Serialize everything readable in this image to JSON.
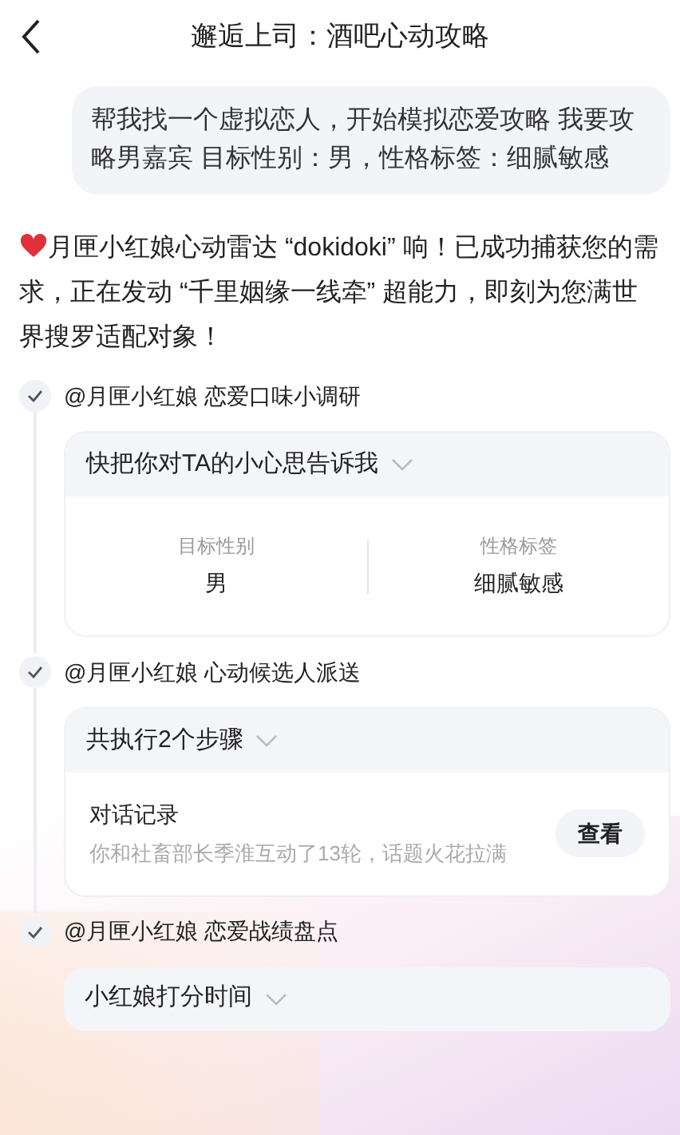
{
  "header": {
    "title": "邂逅上司：酒吧心动攻略"
  },
  "user_message": "帮我找一个虚拟恋人，开始模拟恋爱攻略  我要攻略男嘉宾  目标性别：男，性格标签：细腻敏感",
  "reply": "月匣小红娘心动雷达 “dokidoki” 响！已成功捕获您的需求，正在发动 “千里姻缘一线牵” 超能力，即刻为您满世界搜罗适配对象！",
  "steps": [
    {
      "title": "@月匣小红娘 恋爱口味小调研",
      "kind": "fields",
      "card_title": "快把你对TA的小心思告诉我",
      "fields": [
        {
          "label": "目标性别",
          "value": "男"
        },
        {
          "label": "性格标签",
          "value": "细腻敏感"
        }
      ]
    },
    {
      "title": "@月匣小红娘 心动候选人派送",
      "kind": "record",
      "card_title": "共执行2个步骤",
      "record": {
        "title": "对话记录",
        "detail": "你和社畜部长季淮互动了13轮，话题火花拉满",
        "button": "查看"
      }
    },
    {
      "title": "@月匣小红娘 恋爱战绩盘点",
      "kind": "collapsed",
      "card_title": "小红娘打分时间"
    }
  ]
}
